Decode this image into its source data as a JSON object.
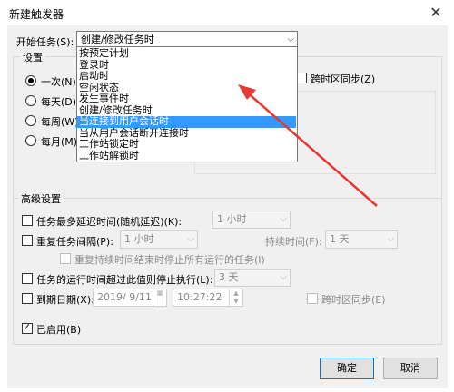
{
  "window": {
    "title": "新建触发器",
    "close_glyph": "✕"
  },
  "begin_task": {
    "label": "开始任务(S):",
    "selected": "创建/修改任务时",
    "options": [
      "按预定计划",
      "登录时",
      "启动时",
      "空闲状态",
      "发生事件时",
      "创建/修改任务时",
      "当连接到用户会话时",
      "当从用户会话断开连接时",
      "工作站锁定时",
      "工作站解锁时"
    ],
    "highlighted_index": 6
  },
  "settings": {
    "title": "设置",
    "radio_once": "一次(N)",
    "radio_daily": "每天(D)",
    "radio_weekly": "每周(W)",
    "radio_monthly": "每月(M)",
    "sync_tz_label": "跨时区同步(Z)"
  },
  "advanced": {
    "title": "高级设置",
    "delay_label": "任务最多延迟时间(随机延迟)(K):",
    "delay_value": "1 小时",
    "repeat_label": "重复任务间隔(P):",
    "repeat_value": "1 小时",
    "duration_label": "持续时间(F):",
    "duration_value": "1 天",
    "stop_all_label": "重复持续时间结束时停止所有运行的任务(I)",
    "stop_longer_label": "任务的运行时间超过此值则停止执行(L):",
    "stop_longer_value": "3 天",
    "expire_label": "到期日期(X):",
    "expire_date": "2019/ 9/11",
    "expire_time": "10:27:22",
    "expire_sync_label": "跨时区同步(E)",
    "enabled_label": "已启用(B)"
  },
  "buttons": {
    "ok": "确定",
    "cancel": "取消"
  },
  "colors": {
    "highlight": "#3399ff",
    "arrow": "#e53935",
    "default_button_border": "#0078d7"
  }
}
